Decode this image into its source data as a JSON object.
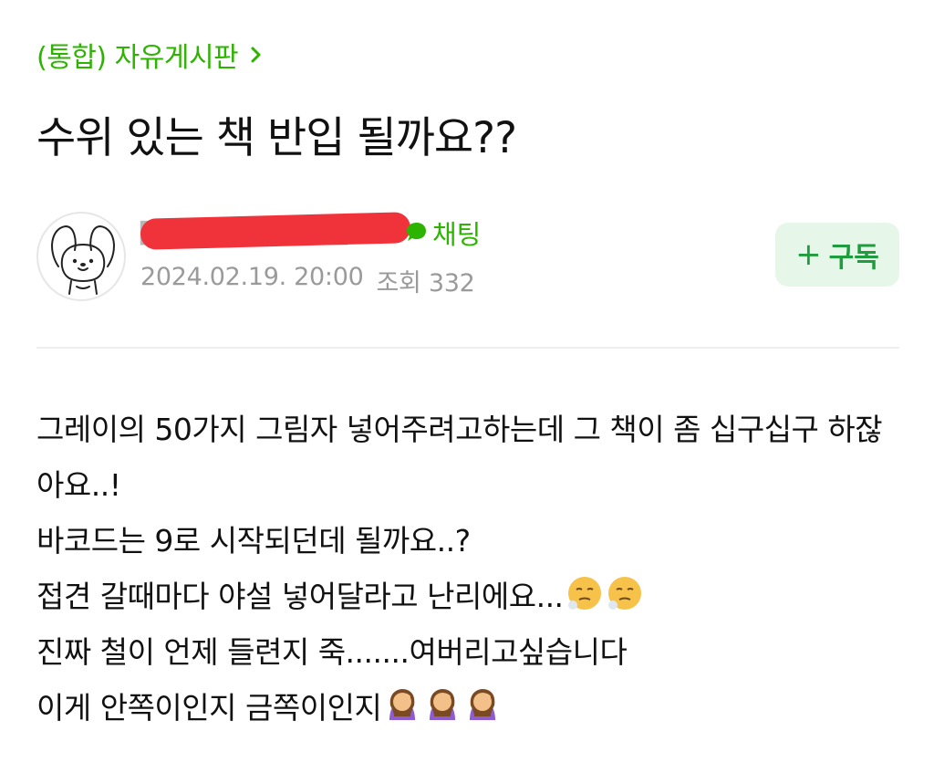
{
  "header": {
    "board_link_label": "(통합) 자유게시판"
  },
  "post": {
    "title": "수위 있는 책 반입 될까요??",
    "author": {
      "chat_label": "채팅"
    },
    "date": "2024.02.19. 20:00",
    "views_label": "조회 332",
    "subscribe_label": "구독"
  },
  "content": {
    "lines": [
      "그레이의 50가지 그림자 넣어주려고하는데 그 책이 좀 십구십구 하잖아요..!",
      "바코드는 9로 시작되던데 될까요..?",
      "접견 갈때마다 야설 넣어달라고 난리에요...",
      "진짜 철이 언제 들련지 죽.......여버리고싶습니다",
      "이게 안쪽이인지 금쪽이인지"
    ],
    "emojis": {
      "line3": [
        "exhale-face",
        "exhale-face"
      ],
      "line5": [
        "facepalm-woman",
        "facepalm-woman",
        "facepalm-woman"
      ]
    }
  },
  "colors": {
    "accent_green": "#2db400",
    "subscribe_bg": "#e6f7e9",
    "redaction_red": "#f0333a",
    "meta_gray": "#9a9a9a"
  }
}
